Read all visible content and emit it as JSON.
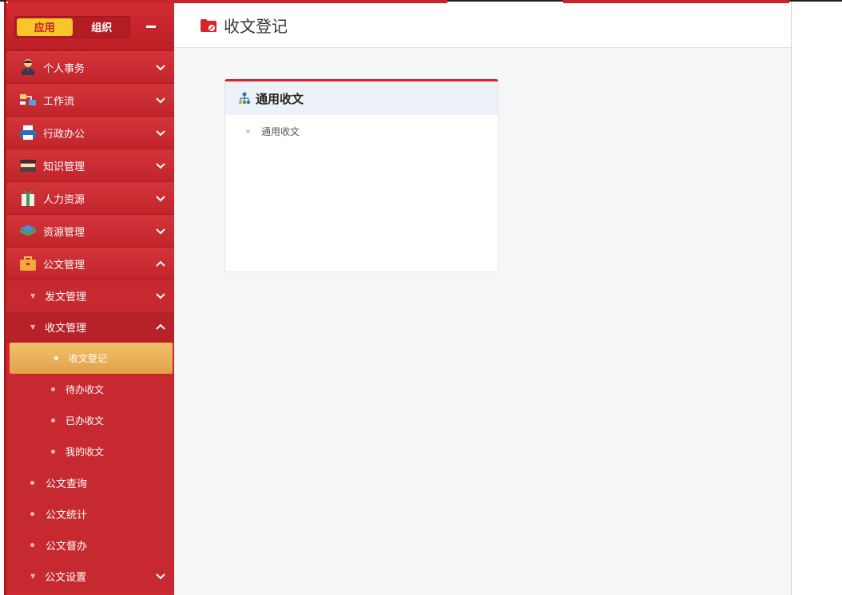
{
  "sidebar": {
    "tabs": [
      "应用",
      "组织"
    ],
    "menu": [
      {
        "label": "个人事务",
        "icon": "person-icon"
      },
      {
        "label": "工作流",
        "icon": "workflow-icon"
      },
      {
        "label": "行政办公",
        "icon": "printer-icon"
      },
      {
        "label": "知识管理",
        "icon": "books-icon"
      },
      {
        "label": "人力资源",
        "icon": "gift-icon"
      },
      {
        "label": "资源管理",
        "icon": "layers-icon"
      },
      {
        "label": "公文管理",
        "icon": "briefcase-icon"
      }
    ],
    "sub": {
      "send": "发文管理",
      "receive": "收文管理",
      "receive_children": [
        "收文登记",
        "待办收文",
        "已办收文",
        "我的收文"
      ],
      "query": "公文查询",
      "stats": "公文统计",
      "supervise": "公文督办",
      "settings": "公文设置"
    }
  },
  "main": {
    "title": "收文登记",
    "card": {
      "title": "通用收文",
      "items": [
        "通用收文"
      ]
    }
  },
  "colors": {
    "sidebar_red": "#cc2a30",
    "active_orange": "#e9ad58",
    "tab_yellow": "#f7c62a",
    "card_accent": "#d8242c"
  }
}
